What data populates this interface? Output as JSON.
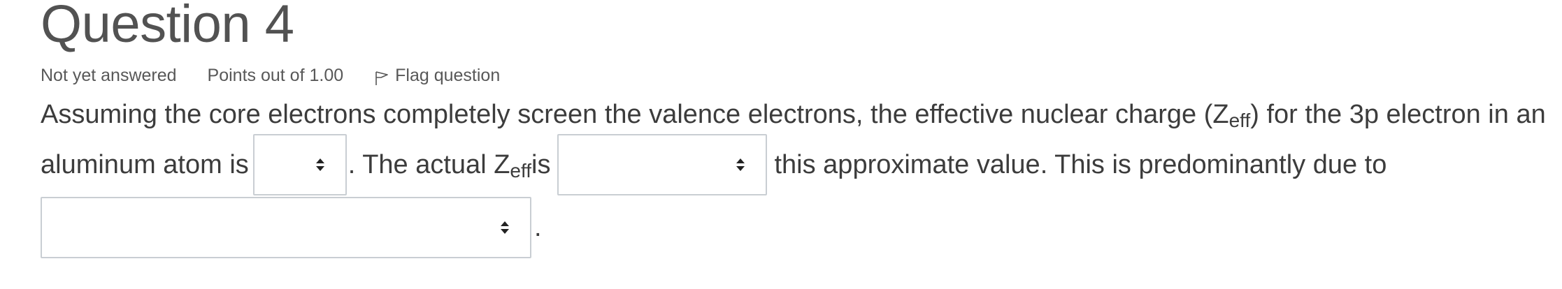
{
  "question": {
    "title": "Question 4",
    "status": "Not yet answered",
    "grade": "Points out of 1.00",
    "flag_label": "Flag question"
  },
  "text": {
    "part1": "Assuming the core electrons completely screen the valence electrons, the effective nuclear charge (Z",
    "sub1": "eff",
    "part2": ") for the 3p electron in an",
    "part3": "aluminum atom is",
    "part4": ". The actual Z",
    "sub2": "eff",
    "part5": " is",
    "part6": "this approximate value.  This is predominantly due to",
    "part7": "."
  },
  "selects": {
    "select1_value": "",
    "select2_value": "",
    "select3_value": ""
  },
  "icons": {
    "flag": "flag-icon",
    "select_caret": "chevron-updown-icon"
  },
  "colors": {
    "title": "#525252",
    "text": "#3c3c3c",
    "select_border": "#c9ced3"
  }
}
